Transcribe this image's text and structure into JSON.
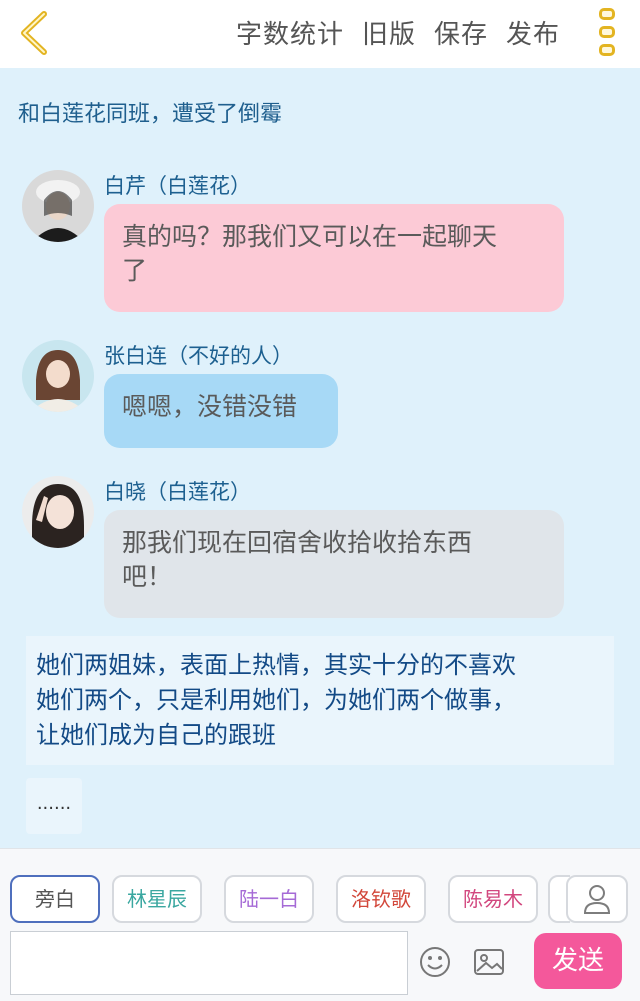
{
  "toolbar": {
    "actions": [
      "字数统计",
      "旧版",
      "保存",
      "发布"
    ]
  },
  "chapter": {
    "title": "和白莲花同班，遭受了倒霉"
  },
  "messages": [
    {
      "speaker": "白芹（白莲花）",
      "text_line1": "真的吗？那我们又可以在一起聊天",
      "text_line2": "了",
      "bubble_color": "#fccad6"
    },
    {
      "speaker": "张白连（不好的人）",
      "text_line1": "嗯嗯，没错没错",
      "bubble_color": "#a7d9f6"
    },
    {
      "speaker": "白晓（白莲花）",
      "text_line1": "那我们现在回宿舍收拾收拾东西",
      "text_line2": "吧！",
      "bubble_color": "#e0e5ea"
    }
  ],
  "narration": {
    "line1": "她们两姐妹，表面上热情，其实十分的不喜欢",
    "line2": "她们两个，只是利用她们，为她们两个做事，",
    "line3": "让她们成为自己的跟班"
  },
  "ellipsis": "......",
  "roles": [
    {
      "label": "旁白",
      "color": "#555555"
    },
    {
      "label": "林星辰",
      "color": "#3aa7a0"
    },
    {
      "label": "陆一白",
      "color": "#a56ad6"
    },
    {
      "label": "洛钦歌",
      "color": "#d2473a"
    },
    {
      "label": "陈易木",
      "color": "#d2477e"
    }
  ],
  "input": {
    "placeholder": ""
  },
  "send_label": "发送",
  "colors": {
    "accent": "#f4589b",
    "menu_dots": "#e3b421",
    "back_arrow": "#e3b421"
  }
}
